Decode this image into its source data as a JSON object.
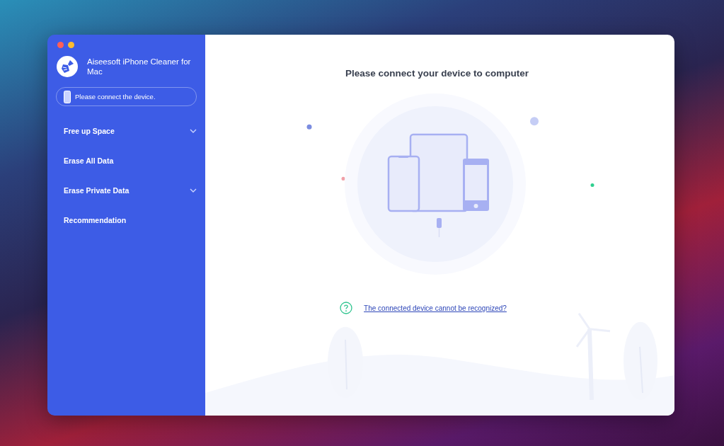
{
  "window": {
    "controls": [
      {
        "kind": "close"
      },
      {
        "kind": "minimize"
      }
    ]
  },
  "sidebar": {
    "app_title": "Aiseesoft iPhone Cleaner for Mac",
    "device_status": "Please connect the device.",
    "items": [
      {
        "label": "Free up Space",
        "expandable": true
      },
      {
        "label": "Erase All Data",
        "expandable": false
      },
      {
        "label": "Erase Private Data",
        "expandable": true
      },
      {
        "label": "Recommendation",
        "expandable": false
      }
    ]
  },
  "main": {
    "title": "Please connect your device to computer",
    "help_link": "The connected device cannot be recognized?"
  }
}
